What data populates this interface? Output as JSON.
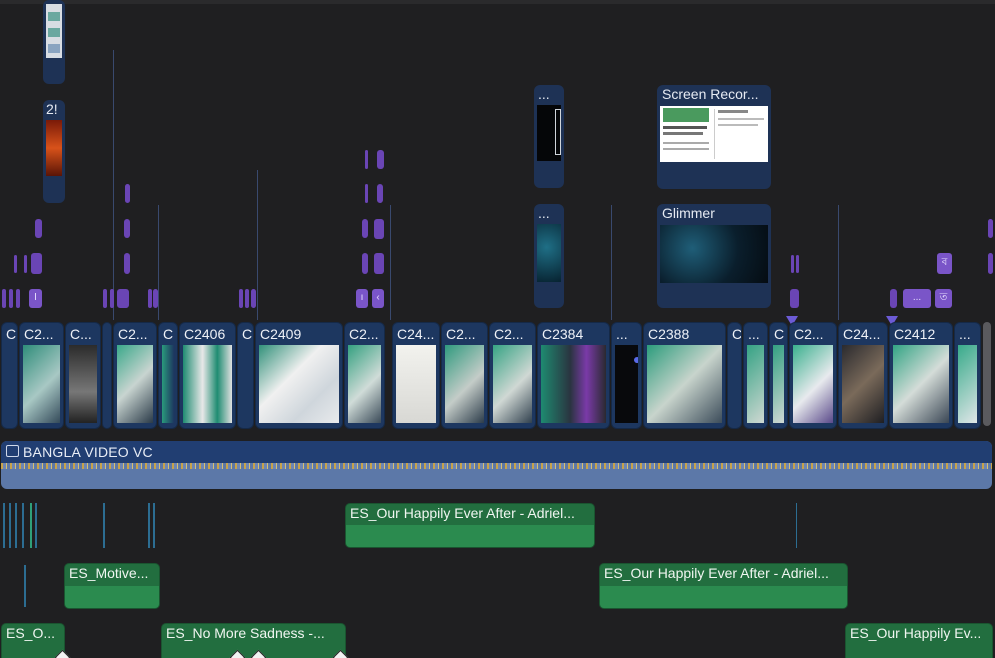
{
  "connected": {
    "clip_top_small_label": "",
    "clip_27_label": "2!",
    "clip_dot1_label": "...",
    "clip_dot2_label": "...",
    "screen_rec_label": "Screen Recor...",
    "glimmer_label": "Glimmer",
    "title_marker_a": "I",
    "title_marker_b": "ı",
    "title_marker_c": "‹",
    "title_marker_d": "ব",
    "title_marker_e": "...",
    "title_marker_f": "ত"
  },
  "primary": {
    "clips": [
      {
        "label": "C"
      },
      {
        "label": "C2..."
      },
      {
        "label": "C..."
      },
      {
        "label": "C2..."
      },
      {
        "label": "C"
      },
      {
        "label": "C2406"
      },
      {
        "label": "C"
      },
      {
        "label": "C2409"
      },
      {
        "label": "C2..."
      },
      {
        "label": "C24..."
      },
      {
        "label": "C2..."
      },
      {
        "label": "C2..."
      },
      {
        "label": "C2384"
      },
      {
        "label": "..."
      },
      {
        "label": "C2388"
      },
      {
        "label": "C"
      },
      {
        "label": "..."
      },
      {
        "label": "C"
      },
      {
        "label": "C2..."
      },
      {
        "label": "C24..."
      },
      {
        "label": "C2412"
      },
      {
        "label": "..."
      }
    ]
  },
  "audio_main": {
    "label": "BANGLA VIDEO VC"
  },
  "music": {
    "lane1": {
      "label": "ES_Our Happily Ever After - Adriel..."
    },
    "lane2_left": {
      "label": "ES_Motive..."
    },
    "lane2_right": {
      "label": "ES_Our Happily Ever After - Adriel..."
    },
    "lane3_a": {
      "label": "ES_O..."
    },
    "lane3_b": {
      "label": "ES_No More Sadness -..."
    },
    "lane3_c": {
      "label": "ES_Our Happily Ev..."
    }
  },
  "colors": {
    "primary_clip": "#1d3760",
    "connected_clip": "#1e3255",
    "title_pill": "#6a45b5",
    "music_clip": "#226e3f",
    "audio_main": "#5c78a8",
    "marker": "#6c5bd6"
  }
}
